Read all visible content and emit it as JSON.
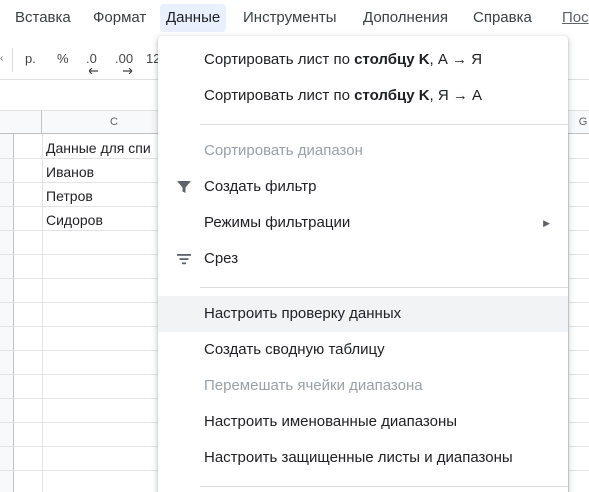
{
  "menubar": {
    "items": [
      {
        "label": "Вставка"
      },
      {
        "label": "Формат"
      },
      {
        "label": "Данные"
      },
      {
        "label": "Инструменты"
      },
      {
        "label": "Дополнения"
      },
      {
        "label": "Справка"
      },
      {
        "label": "Пос"
      }
    ]
  },
  "toolbar": {
    "currency": "р.",
    "percent": "%",
    "dec_decrease": ".0",
    "dec_increase": ".00",
    "number_format": "12"
  },
  "columns": {
    "c": "C",
    "g": "G"
  },
  "cells": [
    "Данные для спи",
    "Иванов",
    "Петров",
    "Сидоров"
  ],
  "data_menu": {
    "sort_az": {
      "prefix": "Сортировать лист по ",
      "bold": "столбцу K",
      "suffix": ", А → Я"
    },
    "sort_za": {
      "prefix": "Сортировать лист по ",
      "bold": "столбцу K",
      "suffix": ", Я → А"
    },
    "sort_range": "Сортировать диапазон",
    "create_filter": "Создать фильтр",
    "filter_views": "Режимы фильтрации",
    "slicer": "Срез",
    "data_validation": "Настроить проверку данных",
    "pivot_table": "Создать сводную таблицу",
    "randomize_range": "Перемешать ячейки диапазона",
    "named_ranges": "Настроить именованные диапазоны",
    "protected_sheets": "Настроить защищенные листы и диапазоны"
  },
  "colors": {
    "active_menu_bg": "#e8f0fe",
    "hover_bg": "#f1f3f4",
    "disabled_text": "#9aa0a6"
  }
}
